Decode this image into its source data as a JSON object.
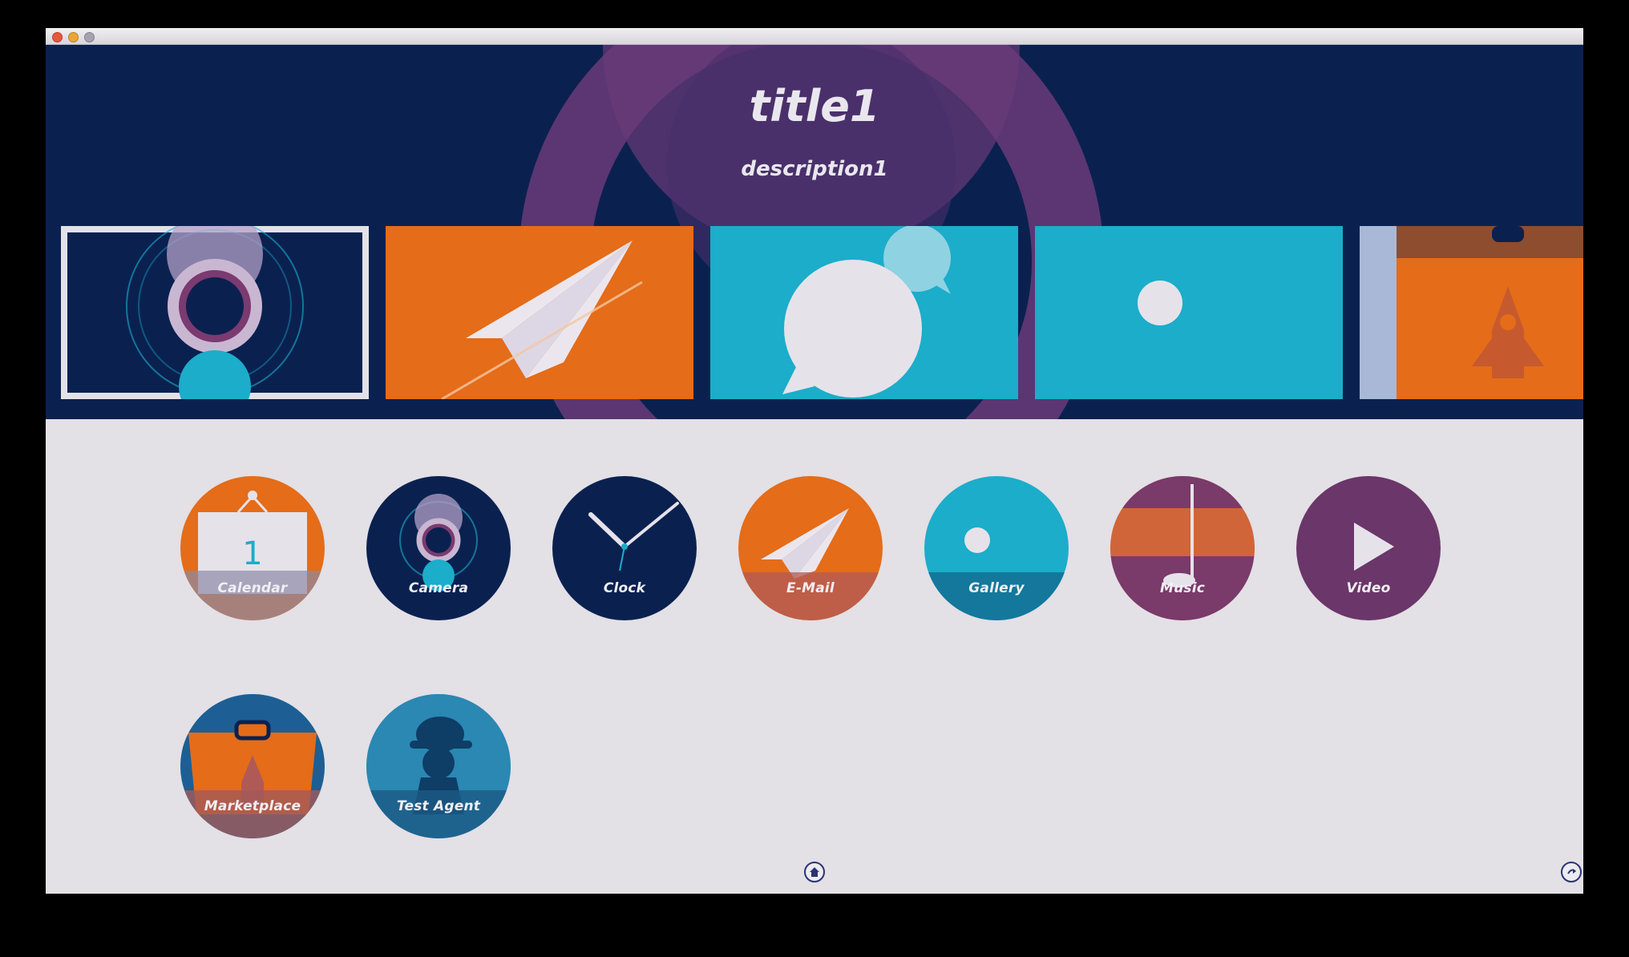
{
  "window": {
    "controls": [
      "close",
      "minimize",
      "maximize"
    ]
  },
  "banner": {
    "title": "title1",
    "description": "description1"
  },
  "carousel": {
    "slides": [
      {
        "icon": "camera-icon",
        "bg": "#0a2150",
        "selected": true
      },
      {
        "icon": "paper-plane-icon",
        "bg": "#e56c18",
        "selected": false
      },
      {
        "icon": "chat-bubble-icon",
        "bg": "#1badca",
        "selected": false
      },
      {
        "icon": "gallery-dot-icon",
        "bg": "#1badca",
        "selected": false
      },
      {
        "icon": "rocket-icon",
        "bg": "#e56c18",
        "selected": false
      }
    ]
  },
  "apps": [
    {
      "label": "Calendar",
      "icon": "calendar-icon",
      "color": "#e56c18"
    },
    {
      "label": "Camera",
      "icon": "camera-icon",
      "color": "#0a2150"
    },
    {
      "label": "Clock",
      "icon": "clock-icon",
      "color": "#0a2150"
    },
    {
      "label": "E-Mail",
      "icon": "paper-plane-icon",
      "color": "#e56c18"
    },
    {
      "label": "Gallery",
      "icon": "gallery-icon",
      "color": "#1badca"
    },
    {
      "label": "Music",
      "icon": "music-note-icon",
      "color": "#7a3a6a"
    },
    {
      "label": "Video",
      "icon": "play-icon",
      "color": "#6b3669"
    },
    {
      "label": "Marketplace",
      "icon": "marketplace-bag-icon",
      "color": "#e56c18"
    },
    {
      "label": "Test Agent",
      "icon": "agent-icon",
      "color": "#1d8fb0"
    }
  ],
  "nav": {
    "home": "home-icon",
    "back": "back-icon"
  }
}
